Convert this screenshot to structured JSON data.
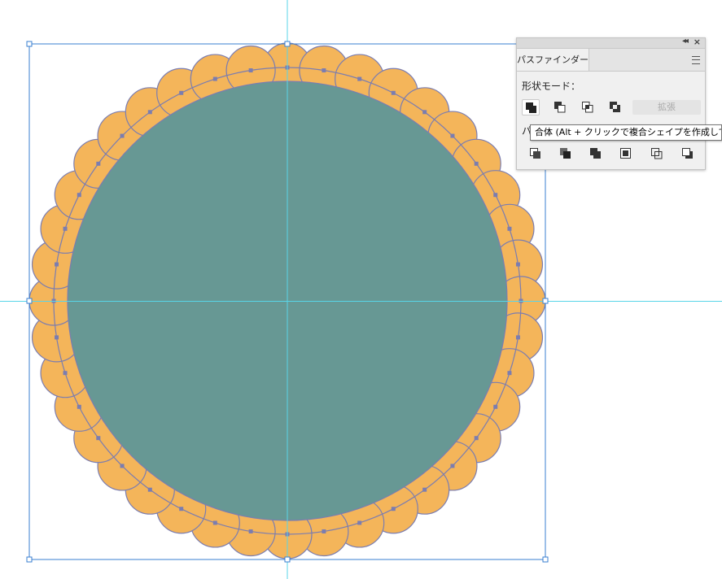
{
  "panel": {
    "tab_label": "パスファインダー",
    "shape_modes_label": "形状モード：",
    "expand_label": "拡張",
    "pathfinders_label": "パ"
  },
  "tooltip": {
    "text": "合体 (Alt + クリックで複合シェイプを作成して追加"
  },
  "artwork": {
    "inner_fill": "#679894",
    "scallop_fill": "#f4b55a",
    "stroke": "#7b7db0",
    "guide": "#58d5e8",
    "selection": "#3a7fd0",
    "scallop_count": 40
  }
}
